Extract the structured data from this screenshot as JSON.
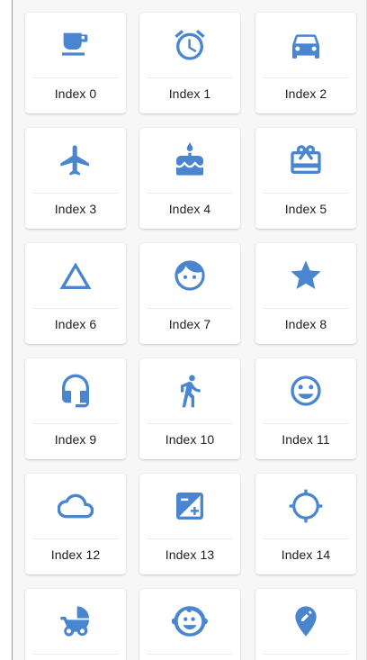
{
  "grid": {
    "accent": "#4a86d0",
    "tiles": [
      {
        "label": "Index 0",
        "icon": "coffee-cup-icon"
      },
      {
        "label": "Index 1",
        "icon": "alarm-clock-icon"
      },
      {
        "label": "Index 2",
        "icon": "car-icon"
      },
      {
        "label": "Index 3",
        "icon": "airplane-icon"
      },
      {
        "label": "Index 4",
        "icon": "birthday-cake-icon"
      },
      {
        "label": "Index 5",
        "icon": "gift-card-icon"
      },
      {
        "label": "Index 6",
        "icon": "triangle-outline-icon"
      },
      {
        "label": "Index 7",
        "icon": "face-icon"
      },
      {
        "label": "Index 8",
        "icon": "star-icon"
      },
      {
        "label": "Index 9",
        "icon": "headset-icon"
      },
      {
        "label": "Index 10",
        "icon": "walking-person-icon"
      },
      {
        "label": "Index 11",
        "icon": "smiley-face-icon"
      },
      {
        "label": "Index 12",
        "icon": "cloud-outline-icon"
      },
      {
        "label": "Index 13",
        "icon": "exposure-icon"
      },
      {
        "label": "Index 14",
        "icon": "gps-target-icon"
      },
      {
        "label": "",
        "icon": "baby-stroller-icon"
      },
      {
        "label": "",
        "icon": "child-face-icon"
      },
      {
        "label": "",
        "icon": "location-pin-edit-icon"
      }
    ]
  }
}
